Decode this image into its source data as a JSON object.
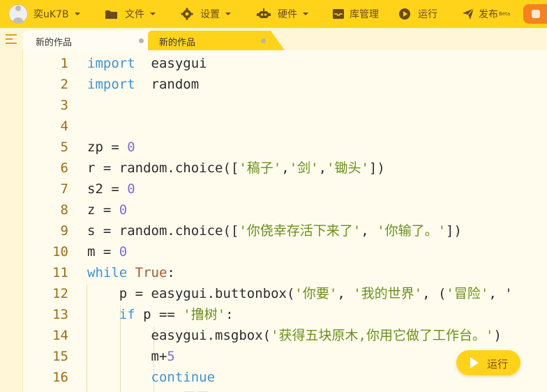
{
  "menubar": {
    "user": "奕uK7B",
    "file": "文件",
    "settings": "设置",
    "hardware": "硬件",
    "library": "库管理",
    "run": "运行",
    "publish": "发布",
    "publish_badge": "Beta"
  },
  "tabs": [
    {
      "label": "新的作品"
    },
    {
      "label": "新的作品"
    }
  ],
  "editor": {
    "lines": [
      {
        "n": "1",
        "tokens": [
          [
            "kw",
            "import"
          ],
          [
            "",
            "  easygui"
          ]
        ]
      },
      {
        "n": "2",
        "tokens": [
          [
            "kw",
            "import"
          ],
          [
            "",
            "  random"
          ]
        ]
      },
      {
        "n": "3",
        "tokens": []
      },
      {
        "n": "4",
        "tokens": []
      },
      {
        "n": "5",
        "tokens": [
          [
            "",
            "zp = "
          ],
          [
            "num",
            "0"
          ]
        ]
      },
      {
        "n": "6",
        "tokens": [
          [
            "",
            "r = random.choice(["
          ],
          [
            "str",
            "'稿子'"
          ],
          [
            "",
            ","
          ],
          [
            "str",
            "'剑'"
          ],
          [
            "",
            ","
          ],
          [
            "str",
            "'锄头'"
          ],
          [
            "",
            "])"
          ]
        ]
      },
      {
        "n": "7",
        "tokens": [
          [
            "",
            "s2 = "
          ],
          [
            "num",
            "0"
          ]
        ]
      },
      {
        "n": "8",
        "tokens": [
          [
            "",
            "z = "
          ],
          [
            "num",
            "0"
          ]
        ]
      },
      {
        "n": "9",
        "tokens": [
          [
            "",
            "s = random.choice(["
          ],
          [
            "str",
            "'你侥幸存活下来了'"
          ],
          [
            "",
            ", "
          ],
          [
            "str",
            "'你输了。'"
          ],
          [
            "",
            "])"
          ]
        ]
      },
      {
        "n": "10",
        "tokens": [
          [
            "",
            "m = "
          ],
          [
            "num",
            "0"
          ]
        ]
      },
      {
        "n": "11",
        "tokens": [
          [
            "kw",
            "while "
          ],
          [
            "bool",
            "True"
          ],
          [
            "",
            ":"
          ]
        ]
      },
      {
        "n": "12",
        "tokens": [
          [
            "",
            "    p = easygui.buttonbox("
          ],
          [
            "str",
            "'你要'"
          ],
          [
            "",
            ", "
          ],
          [
            "str",
            "'我的世界'"
          ],
          [
            "",
            ", ("
          ],
          [
            "str",
            "'冒险'"
          ],
          [
            "",
            ", '"
          ]
        ]
      },
      {
        "n": "13",
        "tokens": [
          [
            "kw",
            "    if"
          ],
          [
            "",
            " p == "
          ],
          [
            "str",
            "'撸树'"
          ],
          [
            "",
            ":"
          ]
        ]
      },
      {
        "n": "14",
        "tokens": [
          [
            "",
            "        easygui.msgbox("
          ],
          [
            "str",
            "'获得五块原木,你用它做了工作台。'"
          ],
          [
            "",
            ")"
          ]
        ]
      },
      {
        "n": "15",
        "tokens": [
          [
            "",
            "        m+"
          ],
          [
            "num",
            "5"
          ]
        ]
      },
      {
        "n": "16",
        "tokens": [
          [
            "kw",
            "        continue"
          ]
        ]
      },
      {
        "n": "",
        "tokens": [
          [
            "",
            "            罚罚"
          ]
        ]
      }
    ]
  },
  "run_button": {
    "label": "运行"
  },
  "colors": {
    "accent": "#ffd31a",
    "editor_bg": "#fffcee",
    "keyword": "#3b93d6",
    "number": "#7a6fd8",
    "string": "#6a8f1c",
    "line_number": "#a16a16"
  }
}
